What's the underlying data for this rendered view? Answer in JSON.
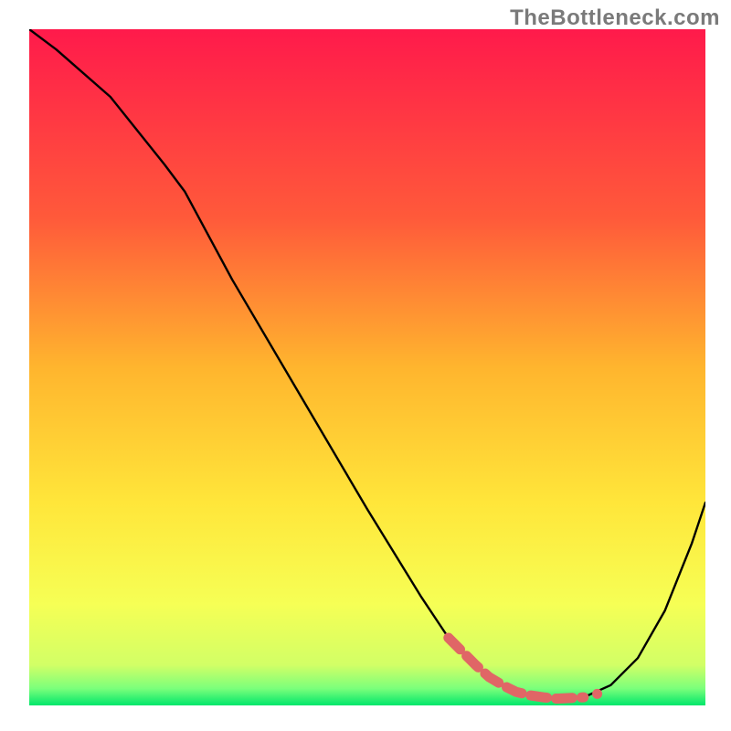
{
  "source_label": "TheBottleneck.com",
  "chart_data": {
    "type": "line",
    "title": "",
    "xlabel": "",
    "ylabel": "",
    "xlim": [
      0,
      100
    ],
    "ylim": [
      0,
      100
    ],
    "grid": false,
    "legend": false,
    "description": "Bottleneck curve over rainbow vertical gradient; minimum (optimal) region near x≈78 highlighted in red.",
    "gradient_stops": [
      {
        "offset": 0.0,
        "color": "#ff1a4b"
      },
      {
        "offset": 0.28,
        "color": "#ff5a3a"
      },
      {
        "offset": 0.5,
        "color": "#ffb52e"
      },
      {
        "offset": 0.7,
        "color": "#ffe63a"
      },
      {
        "offset": 0.85,
        "color": "#f6ff55"
      },
      {
        "offset": 0.94,
        "color": "#d2ff66"
      },
      {
        "offset": 0.975,
        "color": "#7bff7b"
      },
      {
        "offset": 1.0,
        "color": "#00e66b"
      }
    ],
    "series": [
      {
        "name": "bottleneck-curve",
        "color": "#000000",
        "x": [
          0,
          4,
          12,
          20,
          23,
          30,
          40,
          50,
          58,
          62,
          66,
          70,
          74,
          78,
          82,
          86,
          90,
          94,
          98,
          100
        ],
        "y": [
          100,
          97,
          90,
          80,
          76,
          63,
          46,
          29,
          16,
          10,
          6,
          3,
          1.5,
          1,
          1.2,
          3,
          7,
          14,
          24,
          30
        ]
      }
    ],
    "highlight": {
      "name": "optimal-region",
      "color": "#e06666",
      "points_x": [
        62,
        64,
        66,
        68,
        70,
        72,
        74,
        76,
        78,
        80,
        82
      ],
      "points_y": [
        10.0,
        8.0,
        6.0,
        4.2,
        3.0,
        2.0,
        1.5,
        1.2,
        1.0,
        1.1,
        1.2
      ]
    }
  }
}
